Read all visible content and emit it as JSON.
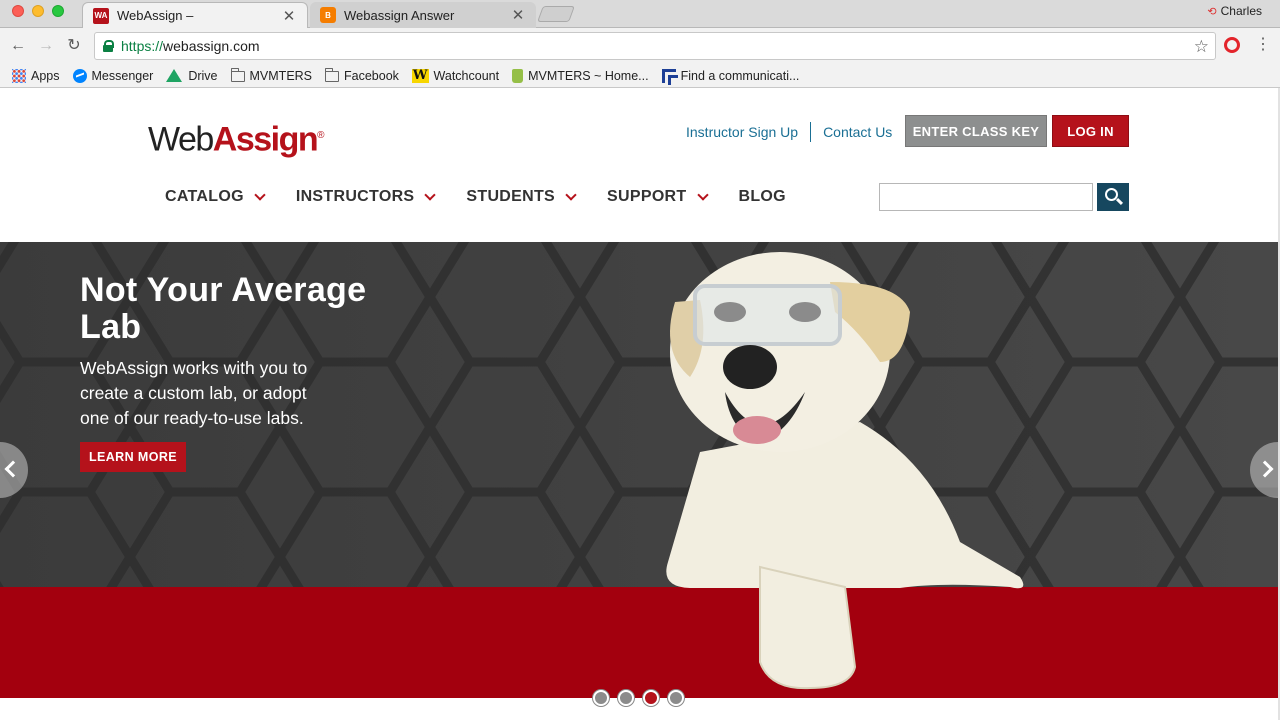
{
  "browser": {
    "tabs": [
      {
        "title": "WebAssign –",
        "favicon": "WA",
        "active": true
      },
      {
        "title": "Webassign Answer",
        "favicon": "blogger-icon",
        "active": false
      }
    ],
    "profile_name": "Charles",
    "url_scheme": "https://",
    "url_host": "webassign.com",
    "bookmarks": [
      {
        "label": "Apps",
        "icon": "apps-grid-icon"
      },
      {
        "label": "Messenger",
        "icon": "messenger-icon"
      },
      {
        "label": "Drive",
        "icon": "drive-icon"
      },
      {
        "label": "MVMTERS",
        "icon": "folder-icon"
      },
      {
        "label": "Facebook",
        "icon": "folder-icon"
      },
      {
        "label": "Watchcount",
        "icon": "w-icon"
      },
      {
        "label": "MVMTERS ~ Home...",
        "icon": "shopify-icon"
      },
      {
        "label": "Find a communicati...",
        "icon": "comm-icon"
      }
    ]
  },
  "site": {
    "logo_web": "Web",
    "logo_assign": "Assign",
    "logo_reg": "®",
    "top_links": {
      "instructor_signup": "Instructor Sign Up",
      "contact": "Contact Us"
    },
    "buttons": {
      "class_key": "ENTER CLASS KEY",
      "login": "LOG IN"
    },
    "nav": [
      "CATALOG",
      "INSTRUCTORS",
      "STUDENTS",
      "SUPPORT",
      "BLOG"
    ],
    "search": {
      "placeholder": ""
    }
  },
  "hero": {
    "title": "Not Your Average Lab",
    "text": "WebAssign works with you to create a custom lab, or adopt one of our ready-to-use labs.",
    "cta": "LEARN MORE",
    "slides_total": 4,
    "active_slide": 3
  },
  "colors": {
    "brand_red": "#b5121b",
    "link_blue": "#1a6f94",
    "search_navy": "#16475f"
  }
}
